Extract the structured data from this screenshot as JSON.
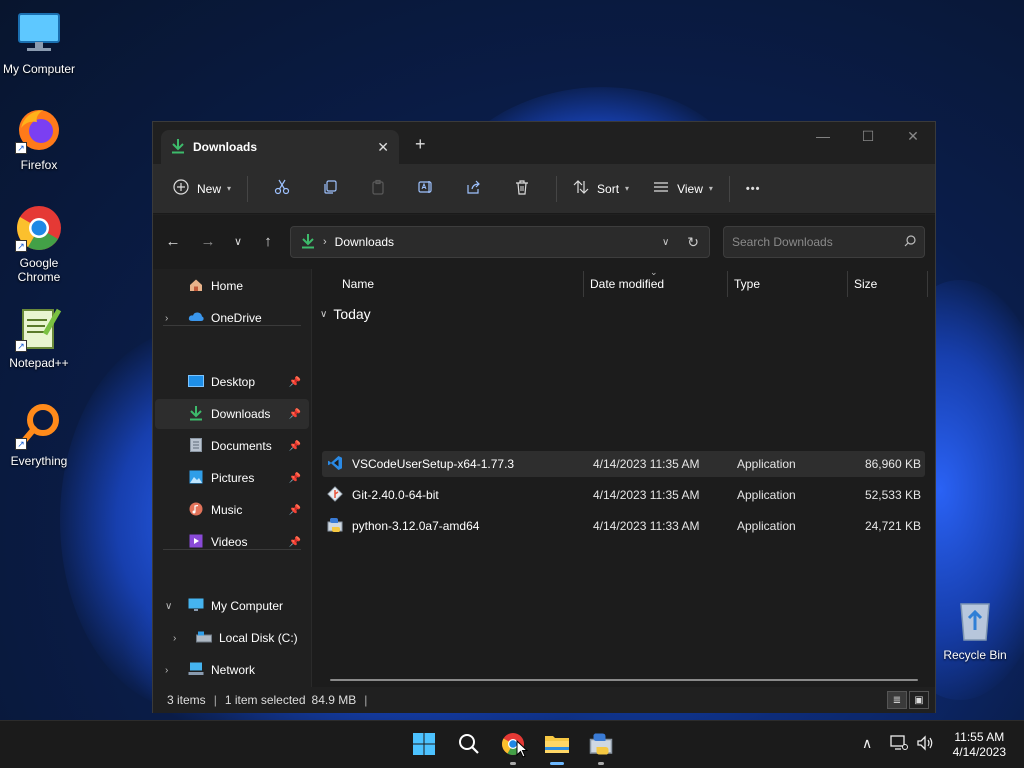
{
  "desktop": {
    "icons": [
      {
        "label": "My Computer"
      },
      {
        "label": "Firefox"
      },
      {
        "label": "Google Chrome"
      },
      {
        "label": "Notepad++"
      },
      {
        "label": "Everything"
      },
      {
        "label": "Recycle Bin"
      }
    ]
  },
  "window": {
    "tab_title": "Downloads",
    "tab_close": "✕",
    "new_tab": "+",
    "controls": {
      "minimize": "—",
      "maximize": "☐",
      "close": "✕"
    }
  },
  "toolbar": {
    "new_label": "New",
    "sort_label": "Sort",
    "view_label": "View",
    "more_label": "•••"
  },
  "address": {
    "crumb": "Downloads",
    "search_placeholder": "Search Downloads"
  },
  "sidebar": {
    "items": [
      {
        "label": "Home"
      },
      {
        "label": "OneDrive"
      },
      {
        "label": "Desktop"
      },
      {
        "label": "Downloads"
      },
      {
        "label": "Documents"
      },
      {
        "label": "Pictures"
      },
      {
        "label": "Music"
      },
      {
        "label": "Videos"
      },
      {
        "label": "My Computer"
      },
      {
        "label": "Local Disk (C:)"
      },
      {
        "label": "Network"
      }
    ]
  },
  "columns": {
    "name": "Name",
    "date": "Date modified",
    "type": "Type",
    "size": "Size"
  },
  "group": {
    "label": "Today"
  },
  "files": [
    {
      "name": "VSCodeUserSetup-x64-1.77.3",
      "date": "4/14/2023 11:35 AM",
      "type": "Application",
      "size": "86,960 KB"
    },
    {
      "name": "Git-2.40.0-64-bit",
      "date": "4/14/2023 11:35 AM",
      "type": "Application",
      "size": "52,533 KB"
    },
    {
      "name": "python-3.12.0a7-amd64",
      "date": "4/14/2023 11:33 AM",
      "type": "Application",
      "size": "24,721 KB"
    }
  ],
  "status": {
    "items": "3 items",
    "selected": "1 item selected",
    "size": "84.9 MB",
    "sep": "|"
  },
  "taskbar": {
    "time": "11:55 AM",
    "date": "4/14/2023"
  },
  "colors": {
    "accent": "#4aa3f0",
    "download_green": "#3dbb6b",
    "window_bg": "#202020"
  }
}
